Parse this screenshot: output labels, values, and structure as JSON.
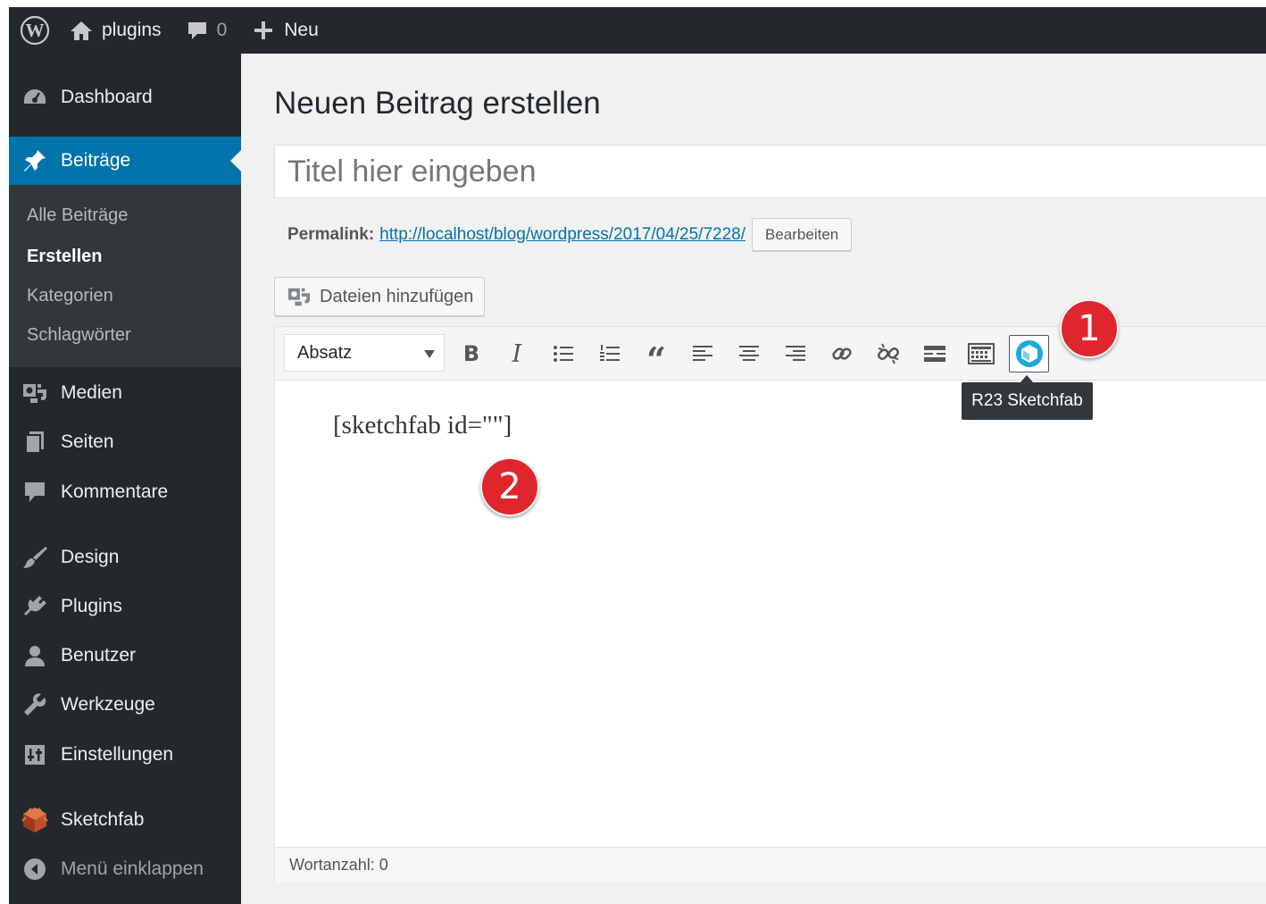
{
  "adminbar": {
    "site_name": "plugins",
    "comment_count": "0",
    "new_label": "Neu",
    "icons": [
      "wordpress-logo-icon",
      "home-icon",
      "comment-icon",
      "plus-icon"
    ]
  },
  "sidebar": {
    "items": [
      {
        "label": "Dashboard",
        "icon": "dashboard-icon"
      },
      {
        "label": "Beiträge",
        "icon": "pin-icon",
        "active": true
      },
      {
        "label": "Medien",
        "icon": "media-icon"
      },
      {
        "label": "Seiten",
        "icon": "pages-icon"
      },
      {
        "label": "Kommentare",
        "icon": "comment-icon"
      },
      {
        "label": "Design",
        "icon": "brush-icon"
      },
      {
        "label": "Plugins",
        "icon": "plugin-icon"
      },
      {
        "label": "Benutzer",
        "icon": "user-icon"
      },
      {
        "label": "Werkzeuge",
        "icon": "wrench-icon"
      },
      {
        "label": "Einstellungen",
        "icon": "settings-icon"
      },
      {
        "label": "Sketchfab",
        "icon": "sketchfab-icon"
      }
    ],
    "submenu": [
      {
        "label": "Alle Beiträge"
      },
      {
        "label": "Erstellen",
        "current": true
      },
      {
        "label": "Kategorien"
      },
      {
        "label": "Schlagwörter"
      }
    ],
    "collapse_label": "Menü einklappen"
  },
  "main": {
    "page_title": "Neuen Beitrag erstellen",
    "title_placeholder": "Titel hier eingeben",
    "permalink_label": "Permalink:",
    "permalink_url": "http://localhost/blog/wordpress/2017/04/25/7228/",
    "edit_button": "Bearbeiten",
    "add_media_button": "Dateien hinzufügen"
  },
  "editor": {
    "format_select": "Absatz",
    "toolbar_icons": [
      "bold-icon",
      "italic-icon",
      "bullet-list-icon",
      "numbered-list-icon",
      "blockquote-icon",
      "align-left-icon",
      "align-center-icon",
      "align-right-icon",
      "link-icon",
      "unlink-icon",
      "read-more-icon",
      "toolbar-toggle-icon",
      "sketchfab-cube-icon"
    ],
    "content": "[sketchfab id=\"\"]",
    "word_count": "Wortanzahl: 0",
    "tooltip": "R23 Sketchfab"
  },
  "annotations": {
    "marker_1": "1",
    "marker_2": "2",
    "marker_color": "#e0262d"
  },
  "colors": {
    "adminbar_bg": "#23282d",
    "active_menu_bg": "#0073aa",
    "link": "#0073aa",
    "sketchfab_blue": "#1caad9"
  }
}
